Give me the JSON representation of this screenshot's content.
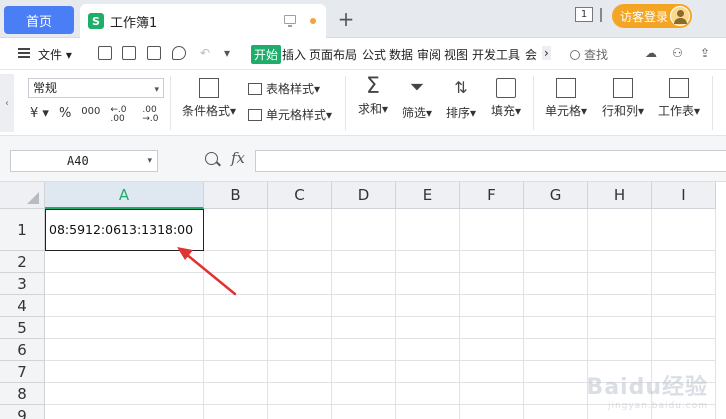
{
  "tabbar": {
    "home_tab": "首页",
    "doc_tab_icon": "S",
    "doc_tab_title": "工作簿1",
    "new_tab": "+",
    "window_count": "1",
    "login_label": "访客登录"
  },
  "menu": {
    "file_label": "文件",
    "tabs": [
      "开始",
      "插入",
      "页面布局",
      "公式",
      "数据",
      "审阅",
      "视图",
      "开发工具",
      "会"
    ],
    "more": "›",
    "search_label": "查找"
  },
  "ribbon": {
    "number_format": "常规",
    "number_buttons": [
      "¥ ▾",
      "%",
      "000",
      "←.0 .00",
      ".00 →.0"
    ],
    "conditional_format": "条件格式▾",
    "table_style": "表格样式▾",
    "cell_style": "单元格样式▾",
    "sum": "求和▾",
    "filter": "筛选▾",
    "sort": "排序▾",
    "fill": "填充▾",
    "cells": "单元格▾",
    "rows_cols": "行和列▾",
    "worksheet": "工作表▾"
  },
  "formula_bar": {
    "name_box": "A40",
    "fx": "fx",
    "formula": ""
  },
  "grid": {
    "columns": [
      "A",
      "B",
      "C",
      "D",
      "E",
      "F",
      "G",
      "H",
      "I"
    ],
    "rows": [
      "1",
      "2",
      "3",
      "4",
      "5",
      "6",
      "7",
      "8",
      "9"
    ],
    "cell_a1": "08:5912:0613:1318:00"
  },
  "watermark": {
    "text": "Baidu经验",
    "sub": "jingyan.baidu.com"
  },
  "colors": {
    "accent_green": "#1fae6a",
    "home_blue": "#4a7ef6",
    "login_orange": "#f5a524",
    "arrow_red": "#e23232"
  }
}
